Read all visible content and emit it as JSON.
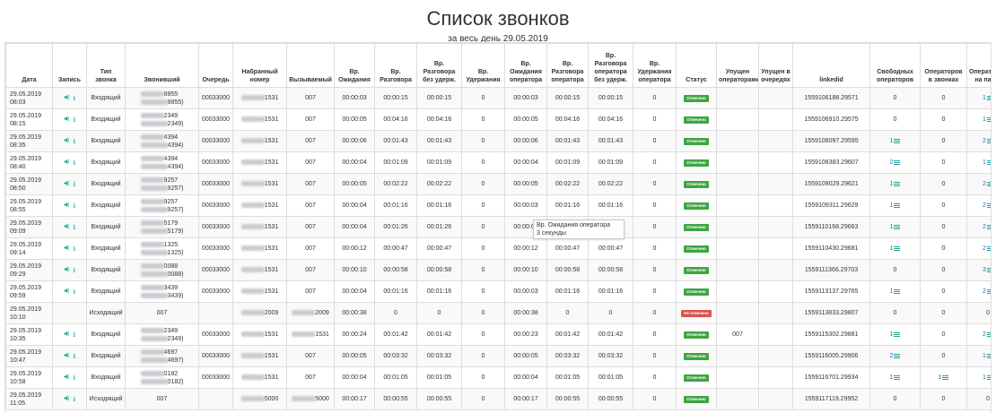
{
  "page": {
    "title": "Список звонков",
    "subtitle": "за весь день 29.05.2019",
    "tooltip": {
      "line1": "Вр. Ожидания оператора",
      "line2": "3 секунды"
    }
  },
  "columns": [
    "Дата",
    "Запись",
    "Тип звонка",
    "Звонивший",
    "Очередь",
    "Набранный номер",
    "Вызываемый",
    "Вр. Ожидания",
    "Вр. Разговора",
    "Вр. Разговора без удерж.",
    "Вр. Удержания",
    "Вр. Ожидания оператора",
    "Вр. Разговора оператора",
    "Вр. Разговора оператора без удерж.",
    "Вр. Удержания оператора",
    "Статус",
    "Упущен операторами",
    "Упущен в очередях",
    "linkedid",
    "Свободных операторов",
    "Операторов в звонках",
    "Операторов на паузе"
  ],
  "icons": {
    "play": "volume-icon",
    "download": "download-icon",
    "list": "list-icon"
  },
  "colors": {
    "accent": "#1ba89a",
    "ok": "#3ea542",
    "missed": "#d9534f",
    "link": "#2a70b8"
  },
  "rows": [
    {
      "date": "29.05.2019",
      "time": "08:03",
      "rec": true,
      "type": "Входящий",
      "caller1": "8855",
      "caller2": "8855)",
      "queue": "00033000",
      "dialed": "1531",
      "called": "007",
      "col_wait": "00:00:03",
      "col_talk": "00:00:15",
      "col_talk_nohold": "00:00:15",
      "col_hold": "0",
      "col_op_wait": "00:00:03",
      "col_op_talk": "00:00:15",
      "col_op_talk_nohold": "00:00:15",
      "col_op_hold": "0",
      "status": "Отвечено",
      "status_ok": true,
      "missed_ops": "",
      "missed_queues": "",
      "linkedid": "1559106188.29571",
      "free_ops": "0",
      "free_ops_link": false,
      "ops_in_calls": "0",
      "ops_in_calls_link": false,
      "ops_paused": "1",
      "ops_paused_link": true
    },
    {
      "date": "29.05.2019",
      "time": "08:15",
      "rec": true,
      "type": "Входящий",
      "caller1": "2349",
      "caller2": "2349)",
      "queue": "00033000",
      "dialed": "1531",
      "called": "007",
      "col_wait": "00:00:05",
      "col_talk": "00:04:16",
      "col_talk_nohold": "00:04:16",
      "col_hold": "0",
      "col_op_wait": "00:00:05",
      "col_op_talk": "00:04:16",
      "col_op_talk_nohold": "00:04:16",
      "col_op_hold": "0",
      "status": "Отвечено",
      "status_ok": true,
      "missed_ops": "",
      "missed_queues": "",
      "linkedid": "1559106910.29575",
      "free_ops": "0",
      "free_ops_link": false,
      "ops_in_calls": "0",
      "ops_in_calls_link": false,
      "ops_paused": "1",
      "ops_paused_link": true
    },
    {
      "date": "29.05.2019",
      "time": "08:35",
      "rec": true,
      "type": "Входящий",
      "caller1": "4394",
      "caller2": "4394)",
      "queue": "00033000",
      "dialed": "1531",
      "called": "007",
      "col_wait": "00:00:06",
      "col_talk": "00:01:43",
      "col_talk_nohold": "00:01:43",
      "col_hold": "0",
      "col_op_wait": "00:00:06",
      "col_op_talk": "00:01:43",
      "col_op_talk_nohold": "00:01:43",
      "col_op_hold": "0",
      "status": "Отвечено",
      "status_ok": true,
      "missed_ops": "",
      "missed_queues": "",
      "linkedid": "1559108097.29595",
      "free_ops": "1",
      "free_ops_link": true,
      "ops_in_calls": "0",
      "ops_in_calls_link": false,
      "ops_paused": "2",
      "ops_paused_link": true
    },
    {
      "date": "29.05.2019",
      "time": "08:40",
      "rec": true,
      "type": "Входящий",
      "caller1": "4394",
      "caller2": "4394)",
      "queue": "00033000",
      "dialed": "1531",
      "called": "007",
      "col_wait": "00:00:04",
      "col_talk": "00:01:09",
      "col_talk_nohold": "00:01:09",
      "col_hold": "0",
      "col_op_wait": "00:00:04",
      "col_op_talk": "00:01:09",
      "col_op_talk_nohold": "00:01:09",
      "col_op_hold": "0",
      "status": "Отвечено",
      "status_ok": true,
      "missed_ops": "",
      "missed_queues": "",
      "linkedid": "1559108383.29607",
      "free_ops": "2",
      "free_ops_link": true,
      "ops_in_calls": "0",
      "ops_in_calls_link": false,
      "ops_paused": "1",
      "ops_paused_link": true
    },
    {
      "date": "29.05.2019",
      "time": "08:50",
      "rec": true,
      "type": "Входящий",
      "caller1": "9257",
      "caller2": "9257)",
      "queue": "00033000",
      "dialed": "1531",
      "called": "007",
      "col_wait": "00:00:05",
      "col_talk": "00:02:22",
      "col_talk_nohold": "00:02:22",
      "col_hold": "0",
      "col_op_wait": "00:00:05",
      "col_op_talk": "00:02:22",
      "col_op_talk_nohold": "00:02:22",
      "col_op_hold": "0",
      "status": "Отвечено",
      "status_ok": true,
      "missed_ops": "",
      "missed_queues": "",
      "linkedid": "1559109029.29621",
      "free_ops": "1",
      "free_ops_link": true,
      "ops_in_calls": "0",
      "ops_in_calls_link": false,
      "ops_paused": "2",
      "ops_paused_link": true
    },
    {
      "date": "29.05.2019",
      "time": "08:55",
      "rec": true,
      "type": "Входящий",
      "caller1": "9257",
      "caller2": "9257)",
      "queue": "00033000",
      "dialed": "1531",
      "called": "007",
      "col_wait": "00:00:04",
      "col_talk": "00:01:16",
      "col_talk_nohold": "00:01:16",
      "col_hold": "0",
      "col_op_wait": "00:00:03",
      "col_op_talk": "00:01:16",
      "col_op_talk_nohold": "00:01:16",
      "col_op_hold": "0",
      "status": "Отвечено",
      "status_ok": true,
      "missed_ops": "",
      "missed_queues": "",
      "linkedid": "1559109311.29629",
      "free_ops": "1",
      "free_ops_link": true,
      "ops_in_calls": "0",
      "ops_in_calls_link": false,
      "ops_paused": "2",
      "ops_paused_link": true
    },
    {
      "date": "29.05.2019",
      "time": "09:09",
      "rec": true,
      "type": "Входящий",
      "caller1": "5179",
      "caller2": "5179)",
      "queue": "00033000",
      "dialed": "1531",
      "called": "007",
      "col_wait": "00:00:04",
      "col_talk": "00:01:26",
      "col_talk_nohold": "00:01:26",
      "col_hold": "0",
      "col_op_wait": "00:00:03",
      "col_op_talk": "",
      "col_op_talk_nohold": "",
      "col_op_hold": "0",
      "status": "Отвечено",
      "status_ok": true,
      "missed_ops": "",
      "missed_queues": "",
      "linkedid": "1559110168.29663",
      "free_ops": "1",
      "free_ops_link": true,
      "ops_in_calls": "0",
      "ops_in_calls_link": false,
      "ops_paused": "2",
      "ops_paused_link": true
    },
    {
      "date": "29.05.2019",
      "time": "09:14",
      "rec": true,
      "type": "Входящий",
      "caller1": "1325",
      "caller2": "1325)",
      "queue": "00033000",
      "dialed": "1531",
      "called": "007",
      "col_wait": "00:00:12",
      "col_talk": "00:00:47",
      "col_talk_nohold": "00:00:47",
      "col_hold": "0",
      "col_op_wait": "00:00:12",
      "col_op_talk": "00:00:47",
      "col_op_talk_nohold": "00:00:47",
      "col_op_hold": "0",
      "status": "Отвечено",
      "status_ok": true,
      "missed_ops": "",
      "missed_queues": "",
      "linkedid": "1559110430.29681",
      "free_ops": "1",
      "free_ops_link": true,
      "ops_in_calls": "0",
      "ops_in_calls_link": false,
      "ops_paused": "2",
      "ops_paused_link": true
    },
    {
      "date": "29.05.2019",
      "time": "09:29",
      "rec": true,
      "type": "Входящий",
      "caller1": "0088",
      "caller2": "0088)",
      "queue": "00033000",
      "dialed": "1531",
      "called": "007",
      "col_wait": "00:00:10",
      "col_talk": "00:00:58",
      "col_talk_nohold": "00:00:58",
      "col_hold": "0",
      "col_op_wait": "00:00:10",
      "col_op_talk": "00:00:58",
      "col_op_talk_nohold": "00:00:58",
      "col_op_hold": "0",
      "status": "Отвечено",
      "status_ok": true,
      "missed_ops": "",
      "missed_queues": "",
      "linkedid": "1559111366.29703",
      "free_ops": "0",
      "free_ops_link": false,
      "ops_in_calls": "0",
      "ops_in_calls_link": false,
      "ops_paused": "3",
      "ops_paused_link": true
    },
    {
      "date": "29.05.2019",
      "time": "09:59",
      "rec": true,
      "type": "Входящий",
      "caller1": "3439",
      "caller2": "3439)",
      "queue": "00033000",
      "dialed": "1531",
      "called": "007",
      "col_wait": "00:00:04",
      "col_talk": "00:01:16",
      "col_talk_nohold": "00:01:16",
      "col_hold": "0",
      "col_op_wait": "00:00:03",
      "col_op_talk": "00:01:16",
      "col_op_talk_nohold": "00:01:16",
      "col_op_hold": "0",
      "status": "Отвечено",
      "status_ok": true,
      "missed_ops": "",
      "missed_queues": "",
      "linkedid": "1559113137.29765",
      "free_ops": "1",
      "free_ops_link": true,
      "ops_in_calls": "0",
      "ops_in_calls_link": false,
      "ops_paused": "2",
      "ops_paused_link": true
    },
    {
      "date": "29.05.2019",
      "time": "10:10",
      "rec": false,
      "type": "Исходящий",
      "caller1": "007",
      "caller2": "",
      "queue": "",
      "dialed": "2009",
      "called": "2009",
      "col_wait": "00:00:38",
      "col_talk": "0",
      "col_talk_nohold": "0",
      "col_hold": "0",
      "col_op_wait": "00:00:38",
      "col_op_talk": "0",
      "col_op_talk_nohold": "0",
      "col_op_hold": "0",
      "status": "Не отвечено",
      "status_ok": false,
      "missed_ops": "",
      "missed_queues": "",
      "linkedid": "1559113833.29807",
      "free_ops": "0",
      "free_ops_link": false,
      "ops_in_calls": "0",
      "ops_in_calls_link": false,
      "ops_paused": "0",
      "ops_paused_link": false
    },
    {
      "date": "29.05.2019",
      "time": "10:35",
      "rec": true,
      "type": "Входящий",
      "caller1": "2349",
      "caller2": "2349)",
      "queue": "00033000",
      "dialed": "1531",
      "called": "1531",
      "col_wait": "00:00:24",
      "col_talk": "00:01:42",
      "col_talk_nohold": "00:01:42",
      "col_hold": "0",
      "col_op_wait": "00:00:23",
      "col_op_talk": "00:01:42",
      "col_op_talk_nohold": "00:01:42",
      "col_op_hold": "0",
      "status": "Отвечено",
      "status_ok": true,
      "missed_ops": "007",
      "missed_queues": "",
      "linkedid": "1559115302.29881",
      "free_ops": "1",
      "free_ops_link": true,
      "ops_in_calls": "0",
      "ops_in_calls_link": false,
      "ops_paused": "2",
      "ops_paused_link": true
    },
    {
      "date": "29.05.2019",
      "time": "10:47",
      "rec": true,
      "type": "Входящий",
      "caller1": "4697",
      "caller2": "4697)",
      "queue": "00033000",
      "dialed": "1531",
      "called": "007",
      "col_wait": "00:00:05",
      "col_talk": "00:03:32",
      "col_talk_nohold": "00:03:32",
      "col_hold": "0",
      "col_op_wait": "00:00:05",
      "col_op_talk": "00:03:32",
      "col_op_talk_nohold": "00:03:32",
      "col_op_hold": "0",
      "status": "Отвечено",
      "status_ok": true,
      "missed_ops": "",
      "missed_queues": "",
      "linkedid": "1559116005.29906",
      "free_ops": "2",
      "free_ops_link": true,
      "ops_in_calls": "0",
      "ops_in_calls_link": false,
      "ops_paused": "1",
      "ops_paused_link": true
    },
    {
      "date": "29.05.2019",
      "time": "10:58",
      "rec": true,
      "type": "Входящий",
      "caller1": "0182",
      "caller2": "0182)",
      "queue": "00033000",
      "dialed": "1531",
      "called": "007",
      "col_wait": "00:00:04",
      "col_talk": "00:01:05",
      "col_talk_nohold": "00:01:05",
      "col_hold": "0",
      "col_op_wait": "00:00:04",
      "col_op_talk": "00:01:05",
      "col_op_talk_nohold": "00:01:05",
      "col_op_hold": "0",
      "status": "Отвечено",
      "status_ok": true,
      "missed_ops": "",
      "missed_queues": "",
      "linkedid": "1559116701.29934",
      "free_ops": "1",
      "free_ops_link": true,
      "ops_in_calls": "1",
      "ops_in_calls_link": true,
      "ops_paused": "1",
      "ops_paused_link": true
    },
    {
      "date": "29.05.2019",
      "time": "11:05",
      "rec": true,
      "type": "Исходящий",
      "caller1": "007",
      "caller2": "",
      "queue": "",
      "dialed": "5000",
      "called": "5000",
      "col_wait": "00:00:17",
      "col_talk": "00:00:55",
      "col_talk_nohold": "00:00:55",
      "col_hold": "0",
      "col_op_wait": "00:00:17",
      "col_op_talk": "00:00:55",
      "col_op_talk_nohold": "00:00:55",
      "col_op_hold": "0",
      "status": "Отвечено",
      "status_ok": true,
      "missed_ops": "",
      "missed_queues": "",
      "linkedid": "1559117119.29952",
      "free_ops": "0",
      "free_ops_link": false,
      "ops_in_calls": "0",
      "ops_in_calls_link": false,
      "ops_paused": "0",
      "ops_paused_link": false
    }
  ]
}
